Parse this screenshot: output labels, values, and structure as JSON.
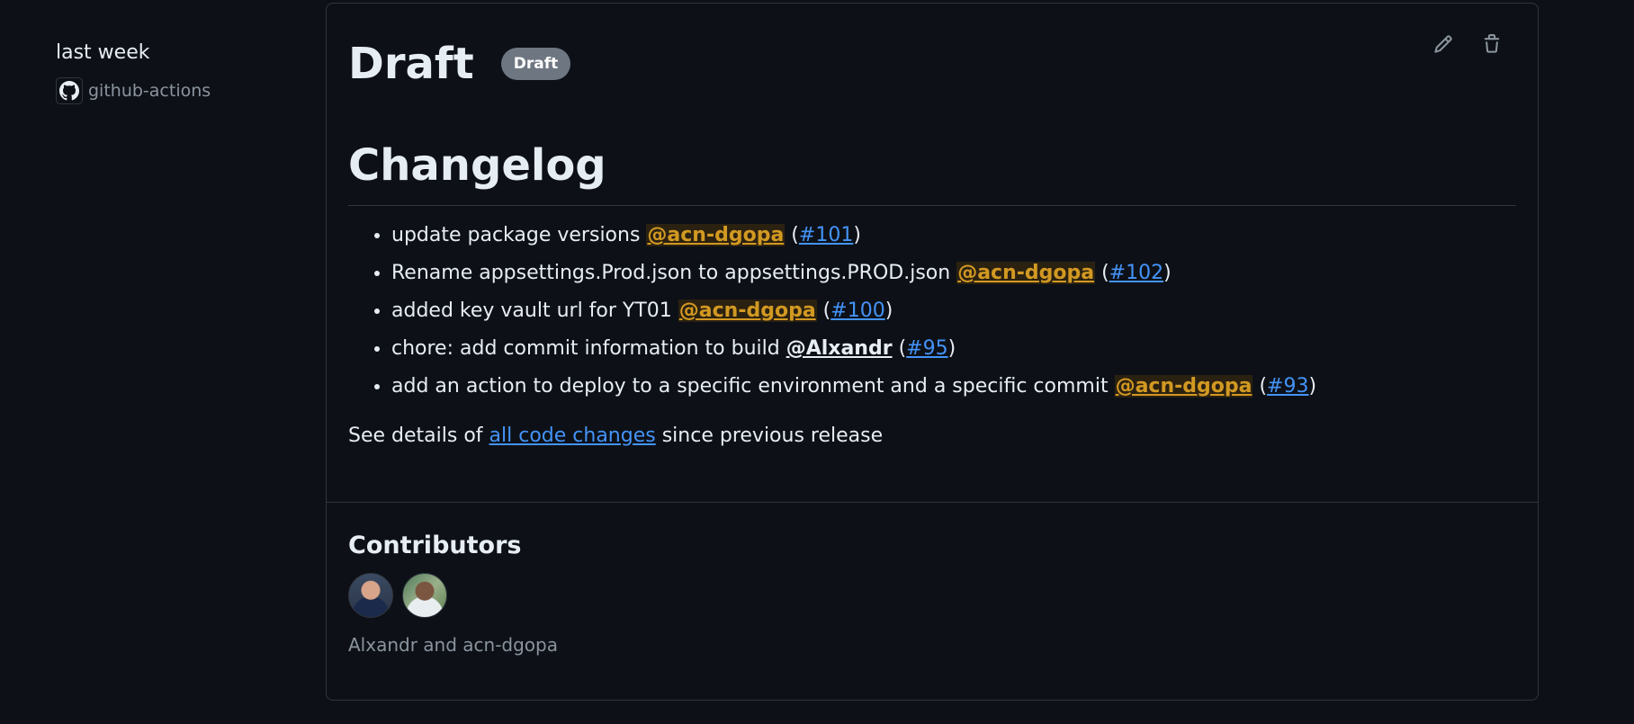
{
  "sidebar": {
    "date": "last week",
    "author": "github-actions"
  },
  "release": {
    "title": "Draft",
    "badge": "Draft",
    "edit_icon": "pencil-icon",
    "delete_icon": "trash-icon"
  },
  "changelog": {
    "heading": "Changelog",
    "items": [
      {
        "text": "update package versions",
        "mention": "@acn-dgopa",
        "pr": "#101"
      },
      {
        "text": "Rename appsettings.Prod.json to appsettings.PROD.json",
        "mention": "@acn-dgopa",
        "pr": "#102"
      },
      {
        "text": "added key vault url for YT01",
        "mention": "@acn-dgopa",
        "pr": "#100"
      },
      {
        "text": "chore: add commit information to build",
        "mention": "@Alxandr",
        "pr": "#95"
      },
      {
        "text": "add an action to deploy to a specific environment and a specific commit",
        "mention": "@acn-dgopa",
        "pr": "#93"
      }
    ],
    "details_prefix": "See details of",
    "details_link": "all code changes",
    "details_suffix": "since previous release"
  },
  "contributors": {
    "heading": "Contributors",
    "names": "Alxandr and acn-dgopa"
  },
  "colors": {
    "background": "#0d1117",
    "mention": "#d29922",
    "link": "#4493f8",
    "badge": "#6e7681"
  }
}
